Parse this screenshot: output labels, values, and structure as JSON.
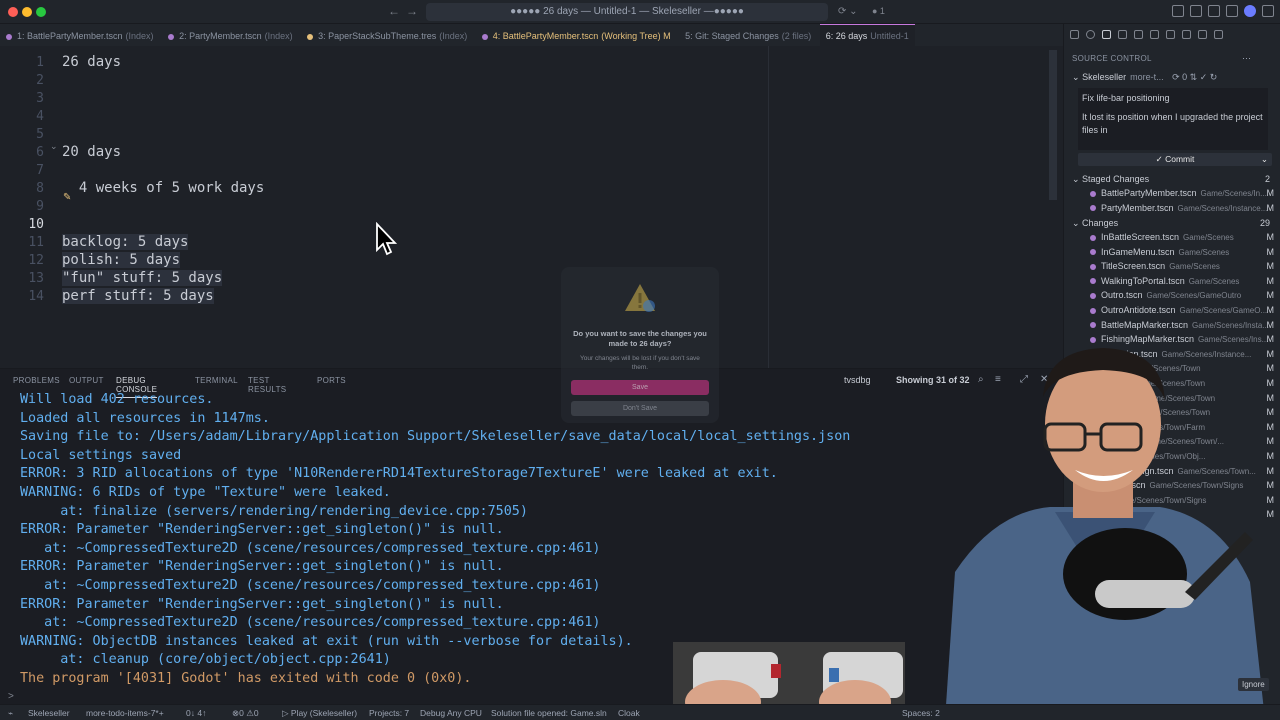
{
  "titlebar": {
    "search_text": "●●●●● 26 days — Untitled-1 — Skeleseller —●●●●●",
    "nav_back": "←",
    "nav_forward": "→",
    "right_info": "● 1"
  },
  "tabs": [
    {
      "label": "1: BattlePartyMember.tscn",
      "suffix": "(Index)",
      "color": "#a97bce"
    },
    {
      "label": "2: PartyMember.tscn",
      "suffix": "(Index)",
      "color": "#a97bce"
    },
    {
      "label": "3: PaperStackSubTheme.tres",
      "suffix": "(Index)",
      "color": "#e5c07b"
    },
    {
      "label": "4: BattlePartyMember.tscn",
      "suffix": "(Working Tree)  M",
      "color": "#a97bce"
    },
    {
      "label": "5: Git: Staged Changes",
      "suffix": "(2 files)",
      "color": ""
    },
    {
      "label": "6: 26 days",
      "suffix": "Untitled-1",
      "color": ""
    }
  ],
  "editor": {
    "lines": [
      {
        "n": "1",
        "text": "26 days"
      },
      {
        "n": "2",
        "text": ""
      },
      {
        "n": "3",
        "text": ""
      },
      {
        "n": "4",
        "text": ""
      },
      {
        "n": "5",
        "text": ""
      },
      {
        "n": "6",
        "text": "20 days"
      },
      {
        "n": "7",
        "text": ""
      },
      {
        "n": "8",
        "text": "  4 weeks of 5 work days"
      },
      {
        "n": "9",
        "text": ""
      },
      {
        "n": "10",
        "text": ""
      },
      {
        "n": "11",
        "text": "backlog: 5 days"
      },
      {
        "n": "12",
        "text": "polish: 5 days"
      },
      {
        "n": "13",
        "text": "\"fun\" stuff: 5 days"
      },
      {
        "n": "14",
        "text": "perf stuff: 5 days"
      }
    ]
  },
  "panel": {
    "tabs": [
      "PROBLEMS",
      "OUTPUT",
      "DEBUG CONSOLE",
      "TERMINAL",
      "TEST RESULTS",
      "PORTS"
    ],
    "debugger": "tvsdbg",
    "showing": "Showing 31 of 32",
    "console": [
      {
        "text": "Will load 402 resources.",
        "kind": "normal"
      },
      {
        "text": "Loaded all resources in 1147ms.",
        "kind": "normal"
      },
      {
        "text": "Saving file to: /Users/adam/Library/Application Support/Skeleseller/save_data/local/local_settings.json",
        "kind": "normal"
      },
      {
        "text": "Local settings saved",
        "kind": "normal"
      },
      {
        "text": "ERROR: 3 RID allocations of type 'N10RendererRD14TextureStorage7TextureE' were leaked at exit.",
        "kind": "normal"
      },
      {
        "text": "WARNING: 6 RIDs of type \"Texture\" were leaked.",
        "kind": "normal"
      },
      {
        "text": "     at: finalize (servers/rendering/rendering_device.cpp:7505)",
        "kind": "normal"
      },
      {
        "text": "ERROR: Parameter \"RenderingServer::get_singleton()\" is null.",
        "kind": "normal"
      },
      {
        "text": "   at: ~CompressedTexture2D (scene/resources/compressed_texture.cpp:461)",
        "kind": "normal"
      },
      {
        "text": "ERROR: Parameter \"RenderingServer::get_singleton()\" is null.",
        "kind": "normal"
      },
      {
        "text": "   at: ~CompressedTexture2D (scene/resources/compressed_texture.cpp:461)",
        "kind": "normal"
      },
      {
        "text": "ERROR: Parameter \"RenderingServer::get_singleton()\" is null.",
        "kind": "normal"
      },
      {
        "text": "   at: ~CompressedTexture2D (scene/resources/compressed_texture.cpp:461)",
        "kind": "normal"
      },
      {
        "text": "WARNING: ObjectDB instances leaked at exit (run with --verbose for details).",
        "kind": "normal"
      },
      {
        "text": "     at: cleanup (core/object/object.cpp:2641)",
        "kind": "normal"
      },
      {
        "text": "The program '[4031] Godot' has exited with code 0 (0x0).",
        "kind": "orange"
      }
    ],
    "prompt": ">"
  },
  "dialog": {
    "title": "Do you want to save the changes you made to 26 days?",
    "body": "Your changes will be lost if you don't save them.",
    "save_label": "Save",
    "dont_save_label": "Don't Save"
  },
  "sidebar": {
    "title": "SOURCE CONTROL",
    "repo": "Skeleseller",
    "branch": "more-t...",
    "commit_message_line1": "Fix life-bar positioning",
    "commit_message_line2": "It lost its position when I upgraded the project files in",
    "commit_label": "Commit",
    "staged_label": "Staged Changes",
    "staged_count": "2",
    "changes_label": "Changes",
    "changes_count": "29",
    "staged": [
      {
        "name": "BattlePartyMember.tscn",
        "path": "Game/Scenes/In...",
        "status": "M"
      },
      {
        "name": "PartyMember.tscn",
        "path": "Game/Scenes/Instance...",
        "status": "M"
      }
    ],
    "changes": [
      {
        "name": "InBattleScreen.tscn",
        "path": "Game/Scenes",
        "status": "M"
      },
      {
        "name": "InGameMenu.tscn",
        "path": "Game/Scenes",
        "status": "M"
      },
      {
        "name": "TitleScreen.tscn",
        "path": "Game/Scenes",
        "status": "M"
      },
      {
        "name": "WalkingToPortal.tscn",
        "path": "Game/Scenes",
        "status": "M"
      },
      {
        "name": "Outro.tscn",
        "path": "Game/Scenes/GameOutro",
        "status": "M"
      },
      {
        "name": "OutroAntidote.tscn",
        "path": "Game/Scenes/GameO...",
        "status": "M"
      },
      {
        "name": "BattleMapMarker.tscn",
        "path": "Game/Scenes/Insta...",
        "status": "M"
      },
      {
        "name": "FishingMapMarker.tscn",
        "path": "Game/Scenes/Ins...",
        "status": "M"
      },
      {
        "name": "...Section.tscn",
        "path": "Game/Scenes/Instance...",
        "status": "M"
      },
      {
        "name": "...tscn",
        "path": "Game/Scenes/Town",
        "status": "M"
      },
      {
        "name": "...l.tscn",
        "path": "Game/Scenes/Town",
        "status": "M"
      },
      {
        "name": "...el2.tscn",
        "path": "Game/Scenes/Town",
        "status": "M"
      },
      {
        "name": "...l3.tscn",
        "path": "Game/Scenes/Town",
        "status": "M"
      },
      {
        "name": "...",
        "path": "Game/Scenes/Town/Farm",
        "status": "M"
      },
      {
        "name": "...ble.tscn",
        "path": "Game/Scenes/Town/...",
        "status": "M"
      },
      {
        "name": "...",
        "path": "Game/Scenes/Town/Obj...",
        "status": "M"
      },
      {
        "name": "...pgradeSign.tscn",
        "path": "Game/Scenes/Town...",
        "status": "M"
      },
      {
        "name": "...Sign.tscn",
        "path": "Game/Scenes/Town/Signs",
        "status": "M"
      },
      {
        "name": "...",
        "path": "Game/Scenes/Town/Signs",
        "status": "M"
      },
      {
        "name": "...",
        "path": "Game/Scenes/To...",
        "status": "M"
      }
    ],
    "ignore_label": "Ignore"
  },
  "statusbar": {
    "repo": "Skeleseller",
    "branch": "more-todo-items-7*+",
    "sync": "0↓ 4↑",
    "problems": "⊗0 ⚠0",
    "play": "▷ Play (Skeleseller)",
    "projects": "Projects: 7",
    "debug": "Debug Any CPU",
    "solution": "Solution file opened: Game.sln",
    "cloak": "Cloak",
    "spaces": "Spaces: 2"
  },
  "colors": {
    "accent": "#c678dd",
    "console_text": "#61afef",
    "console_exit": "#d19a66",
    "save_button": "#8a2d62"
  }
}
